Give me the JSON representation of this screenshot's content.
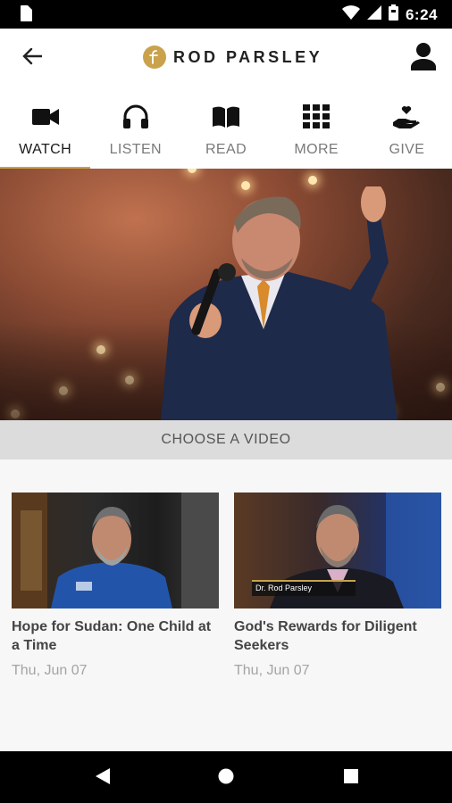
{
  "status_bar": {
    "time": "6:24",
    "icons": [
      "sim-card-icon",
      "wifi-icon",
      "cellular-signal-icon",
      "battery-icon"
    ]
  },
  "app_bar": {
    "brand_name": "ROD PARSLEY",
    "back_icon": "arrow-left-icon",
    "profile_icon": "person-icon"
  },
  "tabs": [
    {
      "label": "WATCH",
      "icon": "video-camera-icon",
      "active": true
    },
    {
      "label": "LISTEN",
      "icon": "headphones-icon",
      "active": false
    },
    {
      "label": "READ",
      "icon": "book-icon",
      "active": false
    },
    {
      "label": "MORE",
      "icon": "grid-icon",
      "active": false
    },
    {
      "label": "GIVE",
      "icon": "hand-heart-icon",
      "active": false
    }
  ],
  "choose_video": {
    "label": "CHOOSE A VIDEO"
  },
  "videos": [
    {
      "title": "Hope for Sudan: One Child at a Time",
      "date": "Thu, Jun 07"
    },
    {
      "title": "God's Rewards for Diligent Seekers",
      "date": "Thu, Jun 07",
      "thumb_caption": "Dr. Rod Parsley"
    }
  ],
  "colors": {
    "accent": "#c9a24b",
    "tab_active_text": "#1a1a1a",
    "tab_inactive_text": "#7a7a7a",
    "choose_bar_bg": "#dcdcdc",
    "video_date": "#a4a4a4"
  }
}
